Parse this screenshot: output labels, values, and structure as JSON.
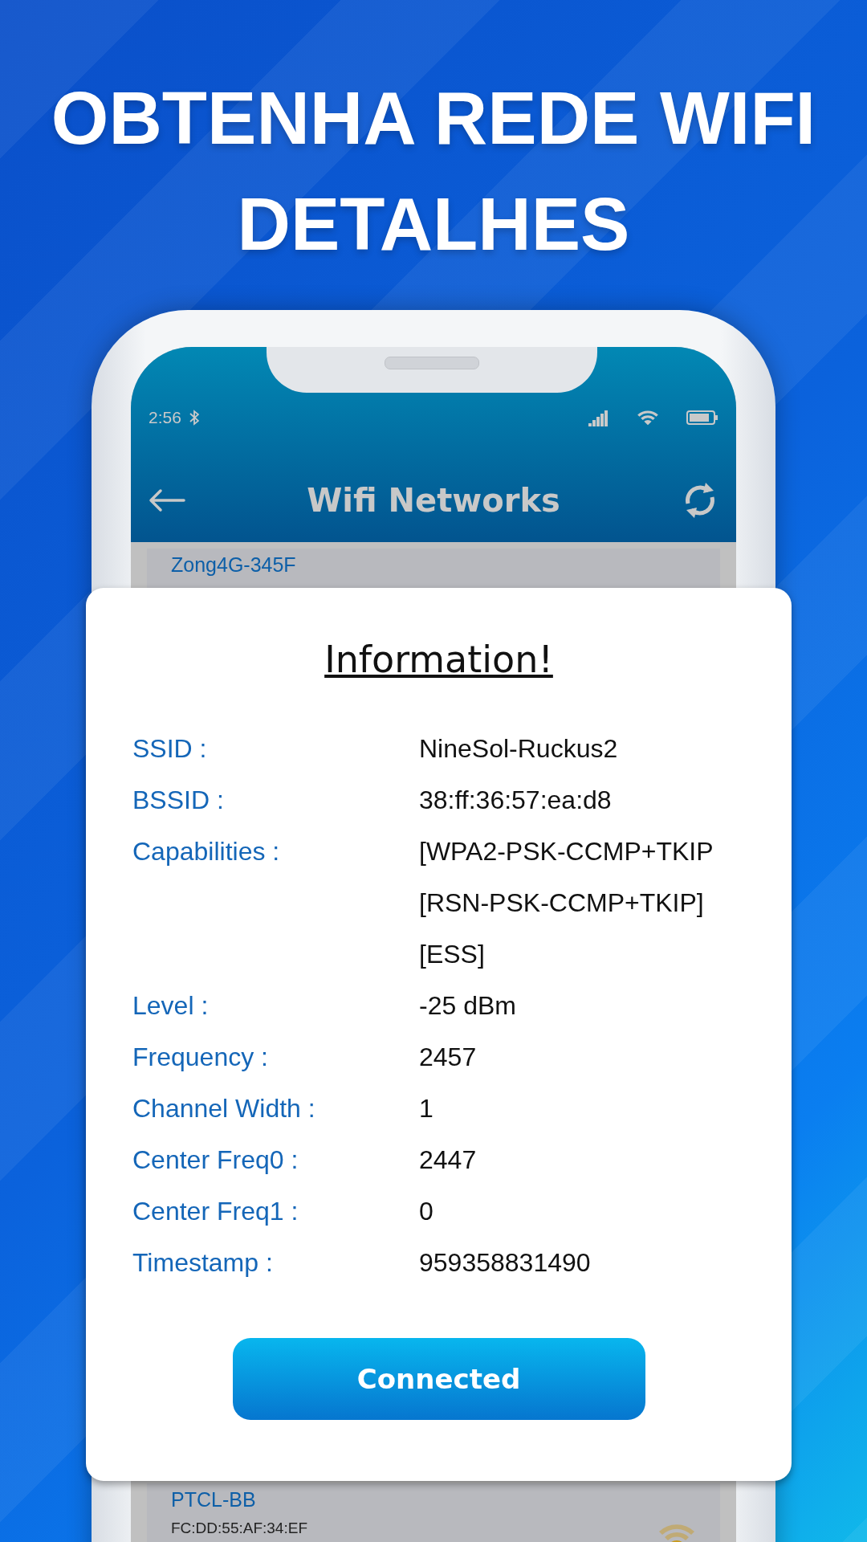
{
  "headline": [
    "OBTENHA REDE WIFI",
    "DETALHES"
  ],
  "status_bar": {
    "time": "2:56"
  },
  "app_bar": {
    "title": "Wifi Networks"
  },
  "networks": [
    {
      "ssid": "Zong4G-345F"
    },
    {
      "ssid": "PTCL-BB",
      "bssid": "FC:DD:55:AF:34:EF"
    }
  ],
  "dialog": {
    "title": "Information!",
    "fields": [
      {
        "label": "SSID :",
        "value": [
          "NineSol-Ruckus2"
        ]
      },
      {
        "label": "BSSID :",
        "value": [
          "38:ff:36:57:ea:d8"
        ]
      },
      {
        "label": "Capabilities :",
        "value": [
          "[WPA2-PSK-CCMP+TKIP",
          "[RSN-PSK-CCMP+TKIP]",
          "[ESS]"
        ]
      },
      {
        "label": "Level :",
        "value": [
          "-25 dBm"
        ]
      },
      {
        "label": "Frequency :",
        "value": [
          "2457"
        ]
      },
      {
        "label": "Channel Width :",
        "value": [
          "1"
        ]
      },
      {
        "label": "Center Freq0 :",
        "value": [
          "2447"
        ]
      },
      {
        "label": "Center Freq1 :",
        "value": [
          "0"
        ]
      },
      {
        "label": "Timestamp :",
        "value": [
          "959358831490"
        ]
      }
    ],
    "button": "Connected"
  }
}
